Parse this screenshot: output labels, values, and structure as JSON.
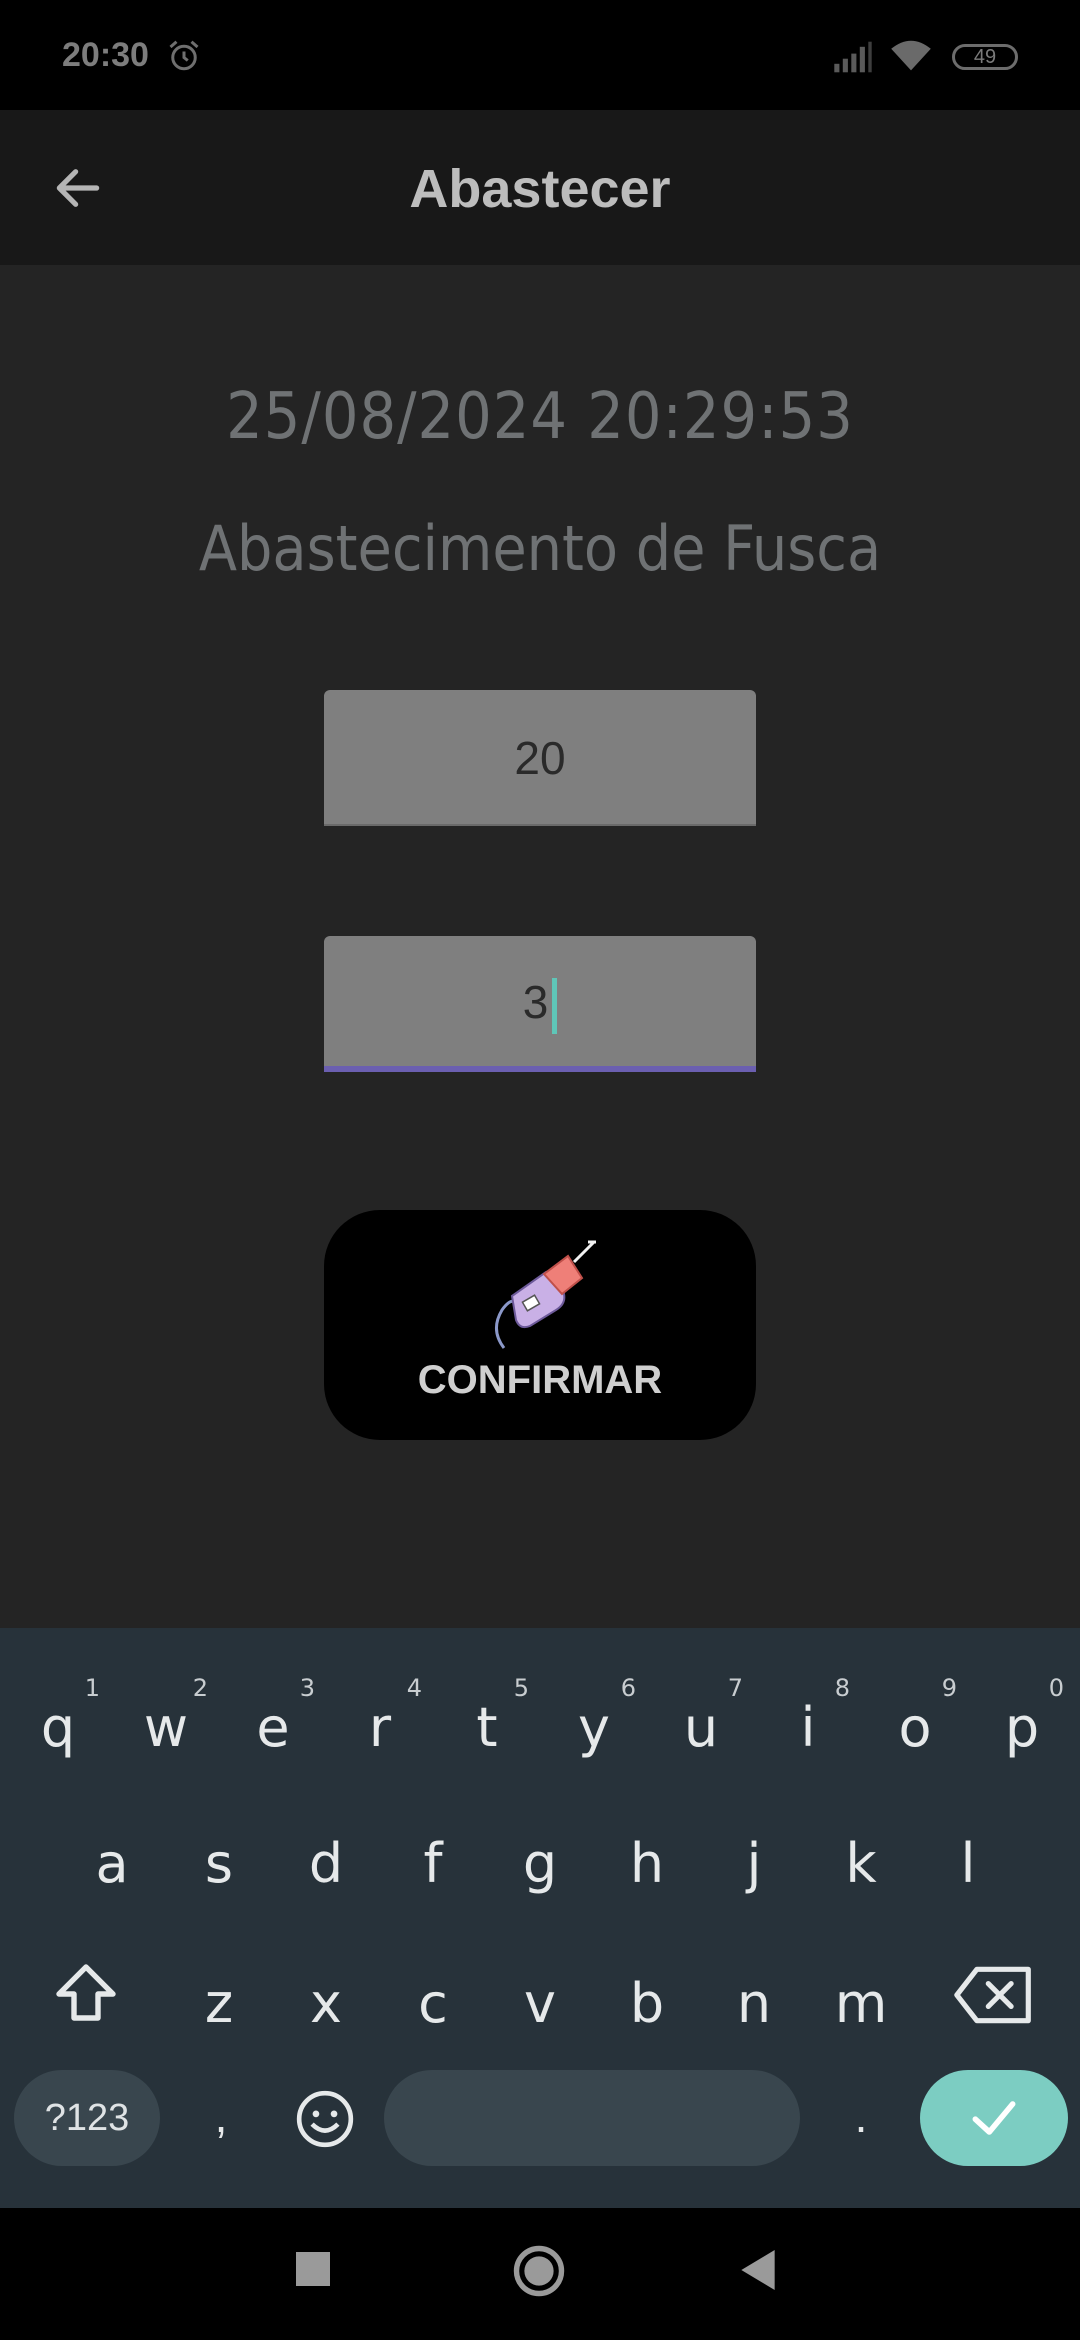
{
  "status_bar": {
    "time": "20:30",
    "battery": "49",
    "icons": [
      "alarm-icon",
      "signal-icon",
      "wifi-icon",
      "battery-icon"
    ]
  },
  "app_bar": {
    "title": "Abastecer",
    "back_icon": "arrow-left-icon"
  },
  "content": {
    "datetime": "25/08/2024 20:29:53",
    "subtitle": "Abastecimento de Fusca",
    "field1_value": "20",
    "field2_value": "3",
    "confirm_label": "CONFIRMAR",
    "confirm_icon": "fuel-pump-icon"
  },
  "keyboard": {
    "row1": [
      {
        "k": "q",
        "n": "1"
      },
      {
        "k": "w",
        "n": "2"
      },
      {
        "k": "e",
        "n": "3"
      },
      {
        "k": "r",
        "n": "4"
      },
      {
        "k": "t",
        "n": "5"
      },
      {
        "k": "y",
        "n": "6"
      },
      {
        "k": "u",
        "n": "7"
      },
      {
        "k": "i",
        "n": "8"
      },
      {
        "k": "o",
        "n": "9"
      },
      {
        "k": "p",
        "n": "0"
      }
    ],
    "row2": [
      "a",
      "s",
      "d",
      "f",
      "g",
      "h",
      "j",
      "k",
      "l"
    ],
    "row3": [
      "z",
      "x",
      "c",
      "v",
      "b",
      "n",
      "m"
    ],
    "symbols_label": "?123",
    "comma": ",",
    "period": ".",
    "icons": [
      "shift-icon",
      "backspace-icon",
      "emoji-icon",
      "check-icon"
    ]
  },
  "nav_bar": {
    "icons": [
      "recents-icon",
      "home-icon",
      "back-triangle-icon"
    ]
  },
  "colors": {
    "background": "#242424",
    "app_bar": "#181818",
    "field": "#7f7f7f",
    "field_underline": "#6b5fb0",
    "caret": "#5fc6b8",
    "keyboard_bg": "#27323a",
    "enter_key": "#7ccdc2"
  }
}
